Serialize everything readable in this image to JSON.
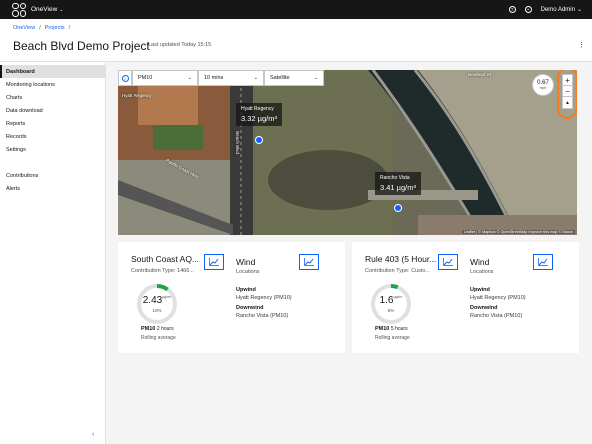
{
  "app": {
    "brand": "OneView",
    "user": "Demo Admin"
  },
  "header": {
    "breadcrumb": [
      "OneView",
      "Projects"
    ],
    "title": "Beach Blvd Demo Project",
    "updated": "Last updated Today 15:15"
  },
  "sidebar": {
    "items": [
      "Dashboard",
      "Monitoring locations",
      "Charts",
      "Data download",
      "Reports",
      "Records",
      "Settings"
    ],
    "items2": [
      "Contributions",
      "Alerts"
    ]
  },
  "map": {
    "pollutant": "PM10",
    "interval": "10 mins",
    "layer": "Satellite",
    "wind_speed": "0.67",
    "wind_unit": "mph",
    "pins": [
      {
        "name": "Hyatt Regency",
        "value": "3.32 µg/m³"
      },
      {
        "name": "Rancho Vista",
        "value": "3.41 µg/m³"
      }
    ],
    "roads": [
      "Pacific Coast Hwy",
      "Beach Blvd",
      "Hyatt Regency",
      "Newland St"
    ],
    "attribution": "Leaflet | © Mapbox © OpenStreetMap Improve this map © Maxar"
  },
  "cards": [
    {
      "title": "South Coast AQ...",
      "subtitle": "Contribution Type: 1466...",
      "value": "2.43",
      "unit": "µg/m³",
      "percent": "10%",
      "fraction": 0.1,
      "pm": "PM10",
      "period": "2 hours",
      "rolling": "Rolling average",
      "wind_title": "Wind",
      "wind_sub": "Locations",
      "upwind_label": "Upwind",
      "upwind": "Hyatt Regency (PM10)",
      "downwind_label": "Downwind",
      "downwind": "Rancho Vista (PM10)"
    },
    {
      "title": "Rule 403 (5 Hour...",
      "subtitle": "Contribution Type: Custo...",
      "value": "1.6",
      "unit": "µg/m³",
      "percent": "6%",
      "fraction": 0.06,
      "pm": "PM10",
      "period": "5 hours",
      "rolling": "Rolling average",
      "wind_title": "Wind",
      "wind_sub": "Locations",
      "upwind_label": "Upwind",
      "upwind": "Hyatt Regency (PM10)",
      "downwind_label": "Downwind",
      "downwind": "Rancho Vista (PM10)"
    }
  ],
  "colors": {
    "accent": "#0f62fe",
    "gauge": "#24a148",
    "highlight": "#f47b20"
  }
}
